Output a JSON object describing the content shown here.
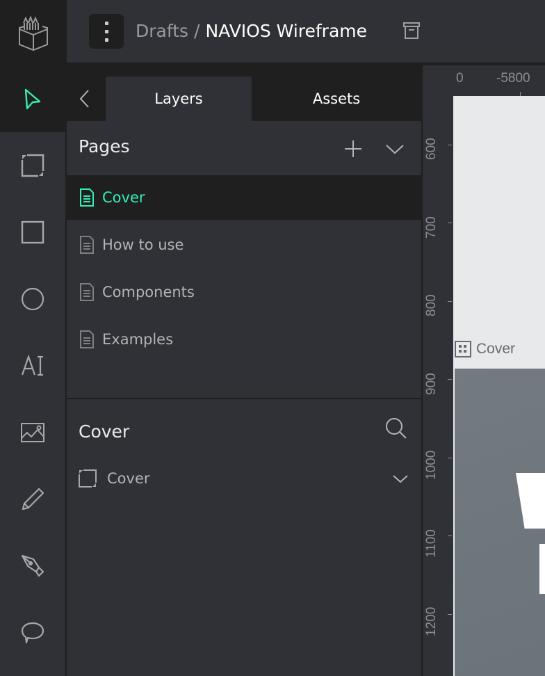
{
  "header": {
    "logo": "pencil-box-logo-icon",
    "menu_icon": "vertical-ellipsis-icon",
    "breadcrumb": {
      "parent": "Drafts",
      "separator": "/",
      "file_name": "NAVIOS Wireframe"
    },
    "archive_icon": "archive-box-icon"
  },
  "toolbar": {
    "tools": [
      {
        "name": "move",
        "icon": "pointer-arrow-icon",
        "active": true
      },
      {
        "name": "board",
        "icon": "board-frame-icon",
        "active": false
      },
      {
        "name": "rectangle",
        "icon": "rectangle-icon",
        "active": false
      },
      {
        "name": "ellipse",
        "icon": "ellipse-icon",
        "active": false
      },
      {
        "name": "text",
        "icon": "text-icon",
        "active": false
      },
      {
        "name": "image",
        "icon": "image-icon",
        "active": false
      },
      {
        "name": "curve",
        "icon": "pencil-icon",
        "active": false
      },
      {
        "name": "path",
        "icon": "pen-nib-icon",
        "active": false
      },
      {
        "name": "comments",
        "icon": "speech-bubble-icon",
        "active": false
      }
    ],
    "text_tool_glyph": "AI"
  },
  "panel": {
    "back_icon": "chevron-left-icon",
    "tabs": [
      {
        "label": "Layers",
        "active": true
      },
      {
        "label": "Assets",
        "active": false
      }
    ],
    "pages": {
      "title": "Pages",
      "add_icon": "plus-icon",
      "collapse_icon": "chevron-down-icon",
      "items": [
        {
          "label": "Cover",
          "active": true
        },
        {
          "label": "How to use",
          "active": false
        },
        {
          "label": "Components",
          "active": false
        },
        {
          "label": "Examples",
          "active": false
        }
      ]
    },
    "layers": {
      "title": "Cover",
      "search_icon": "search-icon",
      "items": [
        {
          "label": "Cover",
          "icon": "board-frame-icon",
          "expand_icon": "chevron-down-icon"
        }
      ]
    }
  },
  "canvas": {
    "ruler_x_labels": [
      "0",
      "-5800"
    ],
    "ruler_y_labels": [
      "600",
      "700",
      "800",
      "900",
      "1000",
      "1100",
      "1200"
    ],
    "artboard_label": "Cover",
    "artboard_icon": "grid-board-icon"
  },
  "colors": {
    "accent": "#31efb8",
    "panel_bg": "#303136",
    "dark_bg": "#1f1f1f",
    "muted_text": "#b4b4b8",
    "artboard_light": "#e8e9eb",
    "artboard_dark": "#6e767c"
  }
}
